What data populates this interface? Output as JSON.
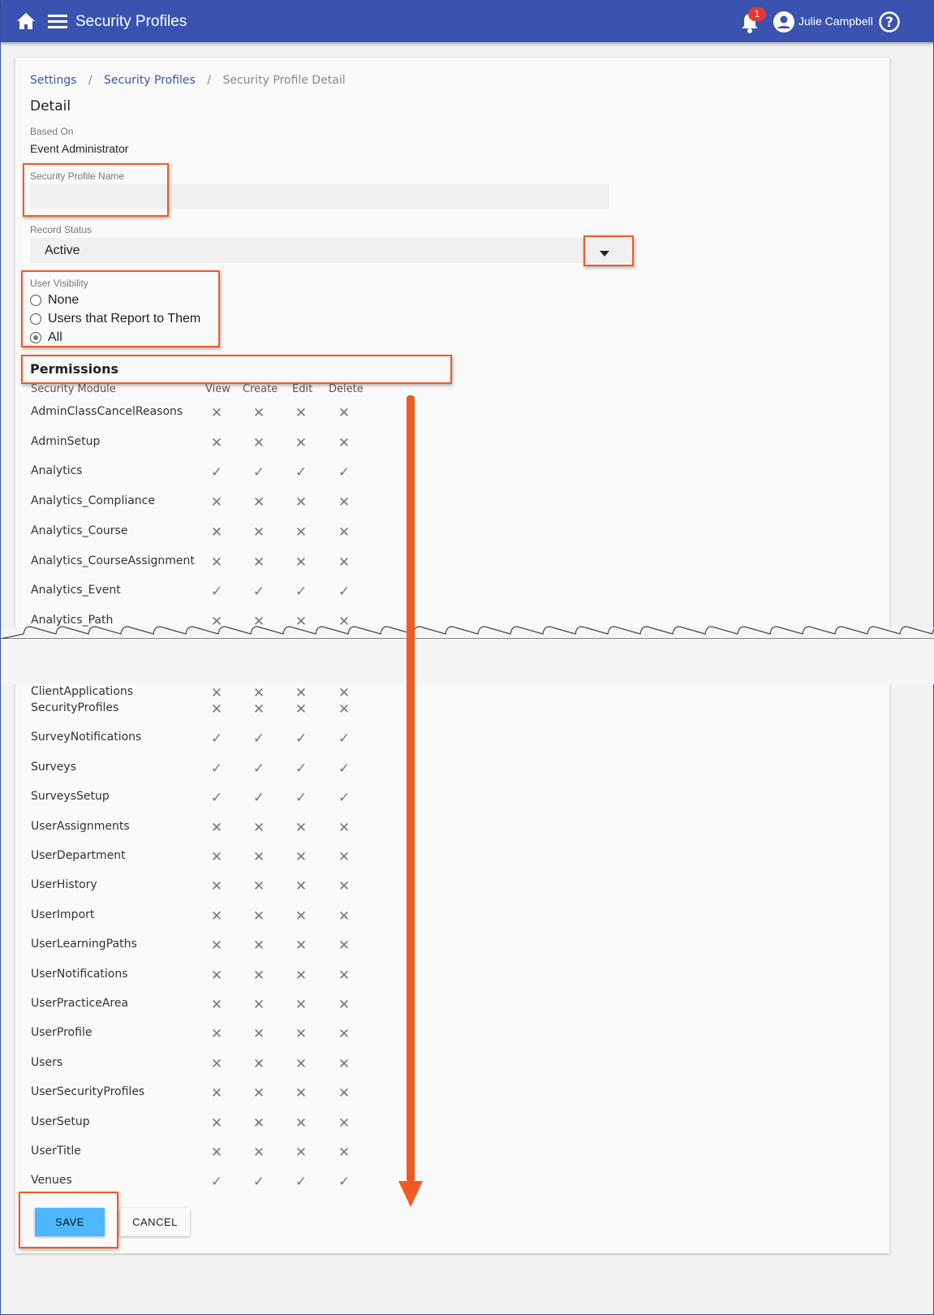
{
  "header": {
    "title": "Security Profiles",
    "user": "Julie Campbell",
    "notifications": "1",
    "icons": [
      "home-icon",
      "menu-icon",
      "bell-icon",
      "account-icon",
      "help-icon"
    ]
  },
  "breadcrumb": [
    {
      "label": "Settings"
    },
    {
      "label": "Security Profiles"
    },
    {
      "label": "Security Profile Detail"
    }
  ],
  "detail": {
    "title": "Detail",
    "based_on_label": "Based On",
    "based_on": "Event Administrator",
    "name_label": "Security Profile Name",
    "name_value": "",
    "status_label": "Record Status",
    "status_value": "Active",
    "visibility_label": "User Visibility",
    "visibility_options": [
      "None",
      "Users that Report to Them",
      "All"
    ],
    "visibility_selected": "All"
  },
  "permissions": {
    "title": "Permissions",
    "columns": [
      "Security Module",
      "View",
      "Create",
      "Edit",
      "Delete"
    ],
    "rows_top": [
      [
        "AdminClassCancelReasons",
        0
      ],
      [
        "AdminSetup",
        0
      ],
      [
        "Analytics",
        1
      ],
      [
        "Analytics_Compliance",
        0
      ],
      [
        "Analytics_Course",
        0
      ],
      [
        "Analytics_CourseAssignment",
        0
      ],
      [
        "Analytics_Event",
        1
      ],
      [
        "Analytics_Path",
        0
      ]
    ],
    "rows_bottom": [
      [
        "ClientApplications",
        0
      ],
      [
        "SecurityProfiles",
        0
      ],
      [
        "SurveyNotifications",
        1
      ],
      [
        "Surveys",
        1
      ],
      [
        "SurveysSetup",
        1
      ],
      [
        "UserAssignments",
        0
      ],
      [
        "UserDepartment",
        0
      ],
      [
        "UserHistory",
        0
      ],
      [
        "UserImport",
        0
      ],
      [
        "UserLearningPaths",
        0
      ],
      [
        "UserNotifications",
        0
      ],
      [
        "UserPracticeArea",
        0
      ],
      [
        "UserProfile",
        0
      ],
      [
        "Users",
        0
      ],
      [
        "UserSecurityProfiles",
        0
      ],
      [
        "UserSetup",
        0
      ],
      [
        "UserTitle",
        0
      ],
      [
        "Venues",
        1
      ]
    ]
  },
  "buttons": {
    "save": "SAVE",
    "cancel": "CANCEL"
  },
  "colors": {
    "header": "#3a53b0",
    "save": "#4db8ff",
    "highlight": "#f15a22"
  }
}
